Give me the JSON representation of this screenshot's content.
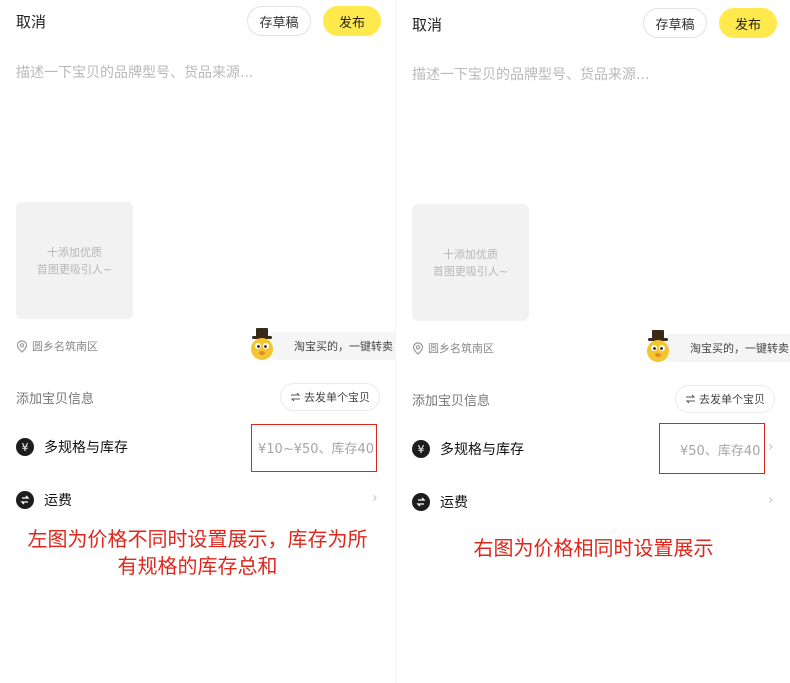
{
  "left": {
    "cancel_label": "取消",
    "draft_label": "存草稿",
    "publish_label": "发布",
    "desc_placeholder": "描述一下宝贝的品牌型号、货品来源...",
    "add_image_line1": "十添加优质",
    "add_image_line2": "首图更吸引人~",
    "location": "圆乡名筑南区",
    "taobao_label": "淘宝买的，一键转卖",
    "info_label": "添加宝贝信息",
    "single_item_label": "去发单个宝贝",
    "spec_label": "多规格与库存",
    "spec_value": "¥10~¥50、库存40",
    "shipping_label": "运费"
  },
  "right": {
    "cancel_label": "取消",
    "draft_label": "存草稿",
    "publish_label": "发布",
    "desc_placeholder": "描述一下宝贝的品牌型号、货品来源...",
    "add_image_line1": "十添加优质",
    "add_image_line2": "首图更吸引人~",
    "location": "圆乡名筑南区",
    "taobao_label": "淘宝买的，一键转卖",
    "info_label": "添加宝贝信息",
    "single_item_label": "去发单个宝贝",
    "spec_label": "多规格与库存",
    "spec_value": "¥50、库存40",
    "shipping_label": "运费"
  },
  "annotations": {
    "left_line1": "左图为价格不同时设置展示，库存为所",
    "left_line2": "有规格的库存总和",
    "right_line1": "右图为价格相同时设置展示"
  },
  "icons": {
    "spec": "yen-icon",
    "shipping": "shipping-icon",
    "location": "location-pin-icon",
    "swap": "swap-arrows-icon",
    "chevron": "chevron-right-icon"
  },
  "colors": {
    "publish": "#ffe94d",
    "highlight": "#e0261c"
  }
}
